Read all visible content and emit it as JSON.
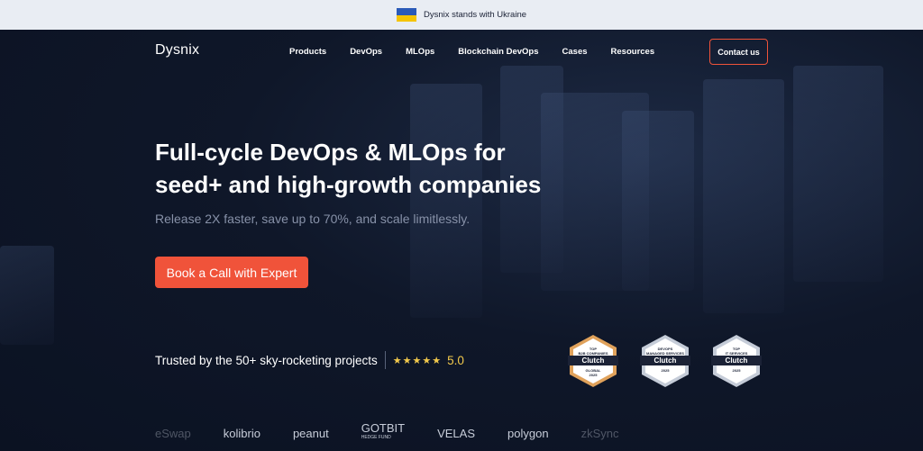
{
  "banner": {
    "text": "Dysnix stands with Ukraine"
  },
  "nav": {
    "logo": "Dysnix",
    "items": [
      "Products",
      "DevOps",
      "MLOps",
      "Blockchain DevOps",
      "Cases",
      "Resources"
    ],
    "contact_label": "Contact us"
  },
  "hero": {
    "headline_line1": "Full-cycle DevOps & MLOps for",
    "headline_line2": "seed+ and high-growth companies",
    "subline": "Release 2X faster, save up to 70%, and scale limitlessly.",
    "cta_label": "Book a Call with Expert"
  },
  "trust": {
    "text": "Trusted by the 50+ sky-rocketing projects",
    "stars": "★★★★★",
    "rating": "5.0"
  },
  "badges": [
    {
      "top": "TOP\nB2B COMPANIES",
      "name": "Clutch",
      "bottom": "GLOBAL\n2025",
      "accent": "#e0a25b"
    },
    {
      "top": "DEVOPS\nMANAGED SERVICES\nCOMPANY",
      "name": "Clutch",
      "bottom": "2025",
      "accent": "#ffffff"
    },
    {
      "top": "TOP\nIT SERVICES\nCOMPANY",
      "name": "Clutch",
      "bottom": "2025",
      "accent": "#ffffff"
    }
  ],
  "client_logos": [
    "eSwap",
    "kolibrio",
    "peanut",
    "GOTBIT",
    "HEDGE FUND",
    "VELAS",
    "polygon",
    "zkSync"
  ],
  "colors": {
    "accent": "#f0533a",
    "star": "#f2c94c",
    "background": "#0d1426"
  }
}
